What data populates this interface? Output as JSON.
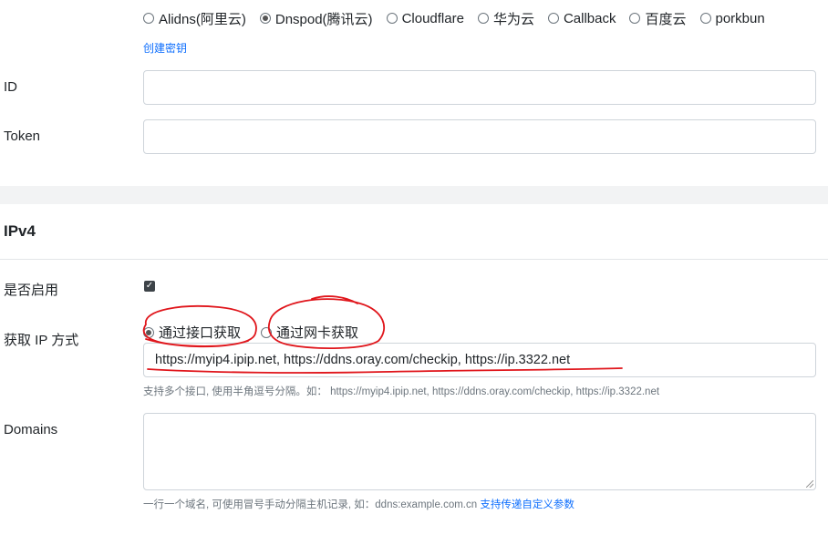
{
  "dns": {
    "providers": [
      {
        "label": "Alidns(阿里云)",
        "checked": false
      },
      {
        "label": "Dnspod(腾讯云)",
        "checked": true
      },
      {
        "label": "Cloudflare",
        "checked": false
      },
      {
        "label": "华为云",
        "checked": false
      },
      {
        "label": "Callback",
        "checked": false
      },
      {
        "label": "百度云",
        "checked": false
      },
      {
        "label": "porkbun",
        "checked": false
      }
    ],
    "create_key_link": "创建密钥",
    "id_label": "ID",
    "id_value": "",
    "token_label": "Token",
    "token_value": ""
  },
  "ipv4": {
    "section_title": "IPv4",
    "enable_label": "是否启用",
    "enabled": true,
    "get_ip_label": "获取 IP 方式",
    "ip_methods": [
      {
        "label": "通过接口获取",
        "checked": true
      },
      {
        "label": "通过网卡获取",
        "checked": false
      }
    ],
    "url_value": "https://myip4.ipip.net, https://ddns.oray.com/checkip, https://ip.3322.net",
    "url_help": "支持多个接口, 使用半角逗号分隔。如： https://myip4.ipip.net, https://ddns.oray.com/checkip, https://ip.3322.net",
    "domains_label": "Domains",
    "domains_value": "",
    "domains_help": "一行一个域名, 可使用冒号手动分隔主机记录, 如：ddns:example.com.cn",
    "domains_help_link": "支持传递自定义参数"
  },
  "colors": {
    "link": "#0d6efd",
    "annotation": "#e0161c",
    "band": "#f2f3f4"
  }
}
